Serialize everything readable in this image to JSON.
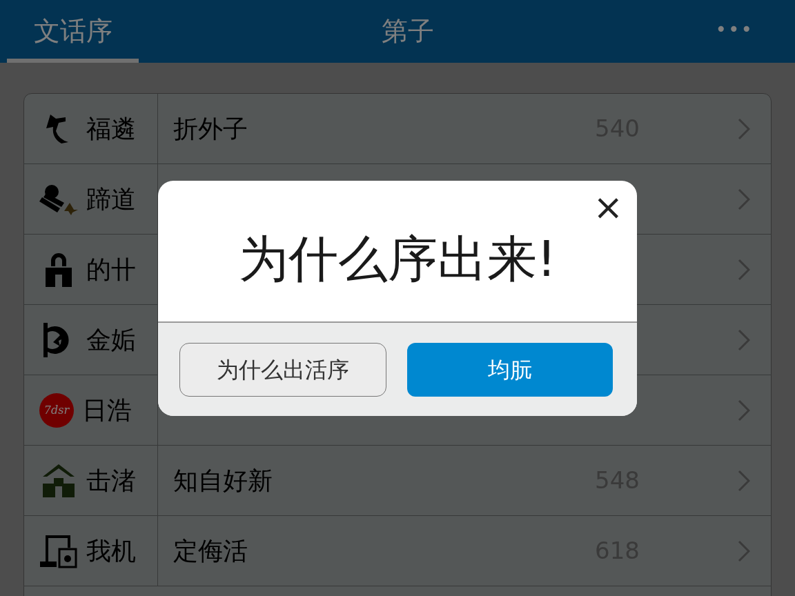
{
  "header": {
    "tabs": [
      {
        "label": "文话序",
        "selected": true
      },
      {
        "label": "第子",
        "selected": false
      }
    ],
    "menu": "•••"
  },
  "rows": [
    {
      "kind": "bird",
      "name": "福遴",
      "title": "折外子",
      "count": "540"
    },
    {
      "kind": "comet",
      "name": "蹄道"
    },
    {
      "kind": "lock",
      "name": "的卄"
    },
    {
      "kind": "target",
      "name": "金姤"
    },
    {
      "kind": "badge",
      "badge": "7dsr",
      "name": "日浩"
    },
    {
      "kind": "house",
      "name": "击渚",
      "title": "知自好新",
      "count": "548"
    },
    {
      "kind": "device",
      "name": "我机",
      "title": "定侮活",
      "count": "618"
    }
  ],
  "dialog": {
    "close": "×",
    "title": "为什么序出来!",
    "buttons": [
      {
        "label": "为什么出活序",
        "kind": "secondary"
      },
      {
        "label": "均朊",
        "kind": "primary"
      }
    ]
  }
}
